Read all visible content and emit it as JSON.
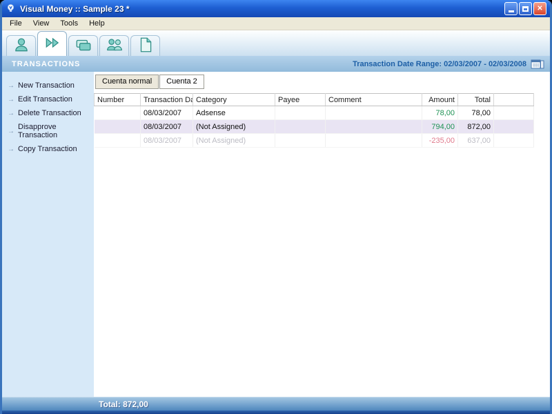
{
  "window": {
    "title": "Visual Money :: Sample 23 *"
  },
  "menu": {
    "items": [
      "File",
      "View",
      "Tools",
      "Help"
    ]
  },
  "toolbar": {
    "buttons": [
      {
        "name": "accounts",
        "icon": "person-icon",
        "active": false
      },
      {
        "name": "transactions",
        "icon": "double-arrow-icon",
        "active": true
      },
      {
        "name": "credit-cards",
        "icon": "card-icon",
        "active": false
      },
      {
        "name": "payees",
        "icon": "people-icon",
        "active": false
      },
      {
        "name": "reports",
        "icon": "report-icon",
        "active": false
      }
    ]
  },
  "header": {
    "title": "TRANSACTIONS",
    "date_range_label": "Transaction Date Range: 02/03/2007 - 02/03/2008"
  },
  "sidebar": {
    "items": [
      {
        "label": "New Transaction"
      },
      {
        "label": "Edit Transaction"
      },
      {
        "label": "Delete Transaction"
      },
      {
        "label": "Disapprove Transaction"
      },
      {
        "label": "Copy Transaction"
      }
    ]
  },
  "tabs": [
    {
      "label": "Cuenta normal",
      "active": true
    },
    {
      "label": "Cuenta 2",
      "active": false
    }
  ],
  "table": {
    "columns": [
      {
        "label": "Number",
        "align": "left"
      },
      {
        "label": "Transaction Date",
        "align": "left"
      },
      {
        "label": "Category",
        "align": "left"
      },
      {
        "label": "Payee",
        "align": "left"
      },
      {
        "label": "Comment",
        "align": "left"
      },
      {
        "label": "Amount",
        "align": "right"
      },
      {
        "label": "Total",
        "align": "right"
      }
    ],
    "rows": [
      {
        "number": "",
        "date": "08/03/2007",
        "category": "Adsense",
        "payee": "",
        "comment": "",
        "amount": "78,00",
        "total": "78,00",
        "state": "normal"
      },
      {
        "number": "",
        "date": "08/03/2007",
        "category": "(Not Assigned)",
        "payee": "",
        "comment": "",
        "amount": "794,00",
        "total": "872,00",
        "state": "selected"
      },
      {
        "number": "",
        "date": "08/03/2007",
        "category": "(Not Assigned)",
        "payee": "",
        "comment": "",
        "amount": "-235,00",
        "total": "637,00",
        "state": "disabled"
      }
    ]
  },
  "footer": {
    "total_label": "Total: 872,00"
  },
  "colors": {
    "banner_text": "#FFFFFF",
    "date_range_text": "#1D5FA6",
    "sidebar_bg": "#D7E9F8",
    "amount_positive": "#1E9254",
    "amount_negative": "#E07A8C",
    "selected_row_bg": "#E9E4F3",
    "disabled_text": "#BCBCC4",
    "footer_text": "#FFFFFF"
  }
}
